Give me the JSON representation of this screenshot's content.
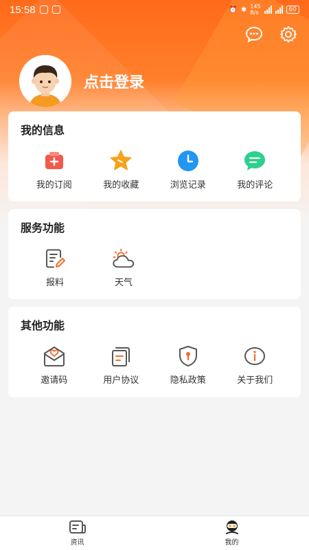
{
  "status_bar": {
    "time": "15:58",
    "net_speed_top": "145",
    "net_speed_bottom": "B/s",
    "battery": "60"
  },
  "header": {
    "login_text": "点击登录",
    "icons": [
      "message-icon",
      "settings-icon"
    ]
  },
  "my_info": {
    "title": "我的信息",
    "items": [
      {
        "label": "我的订阅",
        "icon": "subscription-icon",
        "color": "#f05a4f"
      },
      {
        "label": "我的收藏",
        "icon": "star-icon",
        "color": "#f7a21b"
      },
      {
        "label": "浏览记录",
        "icon": "clock-icon",
        "color": "#2196f3"
      },
      {
        "label": "我的评论",
        "icon": "comment-icon",
        "color": "#2ecf8f"
      }
    ]
  },
  "services": {
    "title": "服务功能",
    "items": [
      {
        "label": "报料",
        "icon": "report-icon"
      },
      {
        "label": "天气",
        "icon": "weather-icon"
      }
    ]
  },
  "other": {
    "title": "其他功能",
    "items": [
      {
        "label": "邀请码",
        "icon": "invite-mail-icon"
      },
      {
        "label": "用户协议",
        "icon": "agreement-icon"
      },
      {
        "label": "隐私政策",
        "icon": "privacy-shield-icon"
      },
      {
        "label": "关于我们",
        "icon": "info-icon"
      }
    ]
  },
  "tabbar": {
    "items": [
      {
        "label": "资讯",
        "icon": "news-icon"
      },
      {
        "label": "我的",
        "icon": "mine-icon"
      }
    ]
  },
  "colors": {
    "accent": "#ff6a1a",
    "icon_stroke": "#555555",
    "icon_accent": "#f26b2a"
  }
}
